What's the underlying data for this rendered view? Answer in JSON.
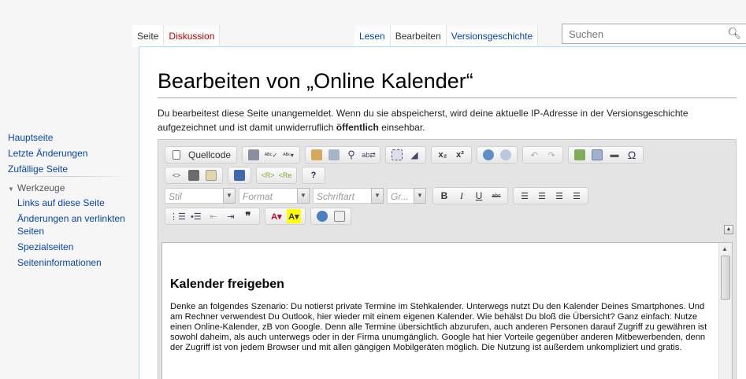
{
  "sidebar": {
    "nav": [
      "Hauptseite",
      "Letzte Änderungen",
      "Zufällige Seite"
    ],
    "tools_heading": "Werkzeuge",
    "tools": [
      "Links auf diese Seite",
      "Änderungen an verlinkten Seiten",
      "Spezialseiten",
      "Seiteninformationen"
    ]
  },
  "tabs": {
    "page": "Seite",
    "discussion": "Diskussion",
    "read": "Lesen",
    "edit": "Bearbeiten",
    "history": "Versionsgeschichte"
  },
  "search": {
    "placeholder": "Suchen"
  },
  "content": {
    "title": "Bearbeiten von „Online Kalender“",
    "notice_pre": "Du bearbeitest diese Seite unangemeldet. Wenn du sie abspeicherst, wird deine aktuelle IP-Adresse in der Versionsgeschichte aufgezeichnet und ist damit unwiderruflich ",
    "notice_bold": "öffentlich",
    "notice_post": " einsehbar."
  },
  "editor": {
    "source_button": "Quellcode",
    "combos": {
      "style": "Stil",
      "format": "Format",
      "font": "Schriftart",
      "size": "Gr..."
    },
    "heading": "Kalender freigeben",
    "paragraph": "Denke  an folgendes Szenario: Du notierst private Termine im Stehkalender. Unterwegs nutzt Du den Kalender Deines Smartphones. Und am Rechner verwendest Du Outlook, hier wieder mit einem eigenen Kalender. Wie behälst Du bloß die Übersicht? Ganz einfach: Nutze einen Online-Kalender, zB von Google. Denn alle Termine übersichtlich abzurufen, auch anderen Personen darauf Zugriff zu gewähren ist sowohl daheim, als auch unterwegs oder in der Firma unumgänglich. Google hat hier Vorteile gegenüber anderen Mitbewerbenden, denn der Zugriff ist von jedem Browser und mit allen gängigen Mobilgeräten möglich. Die Nutzung ist außerdem unkompliziert und gratis."
  }
}
